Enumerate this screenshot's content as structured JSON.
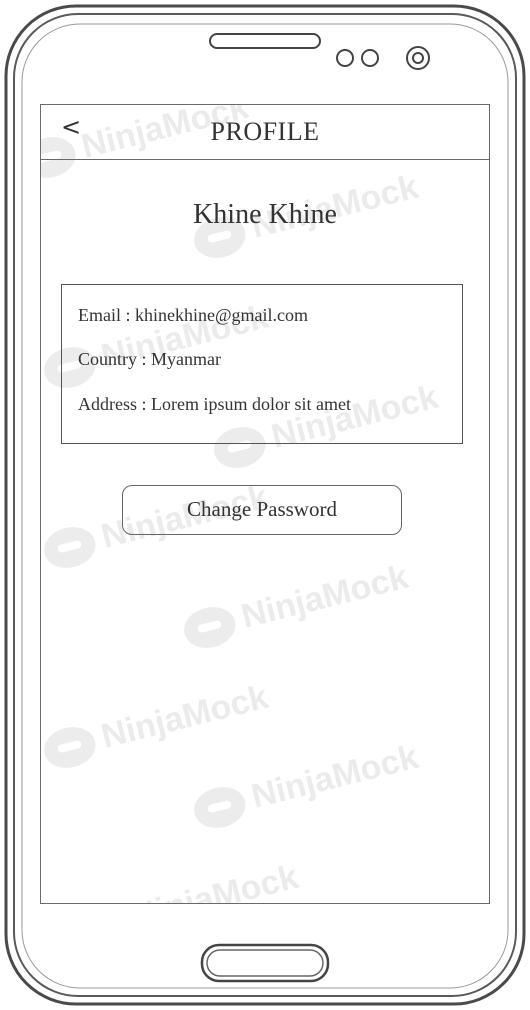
{
  "header": {
    "back_label": "<",
    "title": "PROFILE"
  },
  "profile": {
    "name": "Khine Khine",
    "email_line": "Email : khinekhine@gmail.com",
    "country_line": "Country : Myanmar",
    "address_line": "Address : Lorem ipsum dolor sit amet"
  },
  "actions": {
    "change_password_label": "Change Password"
  },
  "watermark": {
    "text": "NinjaMock"
  },
  "colors": {
    "outline": "#555555",
    "text": "#333333",
    "watermark": "#ebebeb"
  },
  "icons": {
    "back": "chevron-left-icon",
    "camera": "camera-icon",
    "sensor": "sensor-icon",
    "home": "home-button-icon"
  }
}
